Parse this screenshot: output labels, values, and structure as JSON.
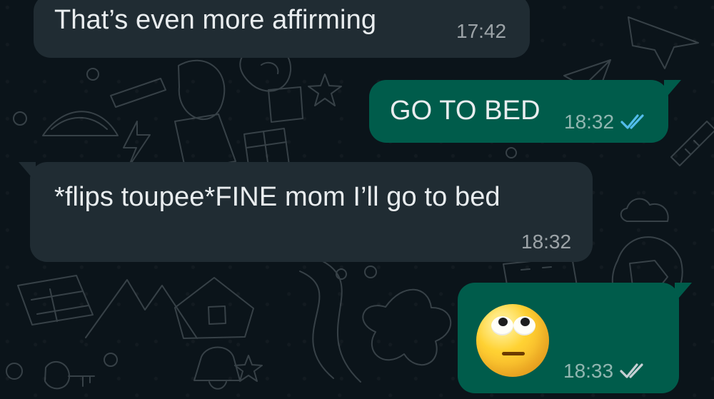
{
  "colors": {
    "chat_background": "#0b141a",
    "incoming_bubble": "#202c33",
    "outgoing_bubble": "#005c4b",
    "read_receipt": "#53bdeb",
    "delivered_receipt": "#c7d0d4",
    "text": "#e9edef"
  },
  "messages": [
    {
      "direction": "incoming",
      "text": "That’s even more affirming",
      "time": "17:42"
    },
    {
      "direction": "outgoing",
      "text": "GO TO BED",
      "time": "18:32",
      "receipt_icon": "double-check-read-icon"
    },
    {
      "direction": "incoming",
      "text": "*flips toupee*FINE mom I’ll go to bed",
      "time": "18:32"
    },
    {
      "direction": "outgoing",
      "emoji_icon": "face-with-rolling-eyes-emoji",
      "time": "18:33",
      "receipt_icon": "double-check-delivered-icon"
    }
  ]
}
